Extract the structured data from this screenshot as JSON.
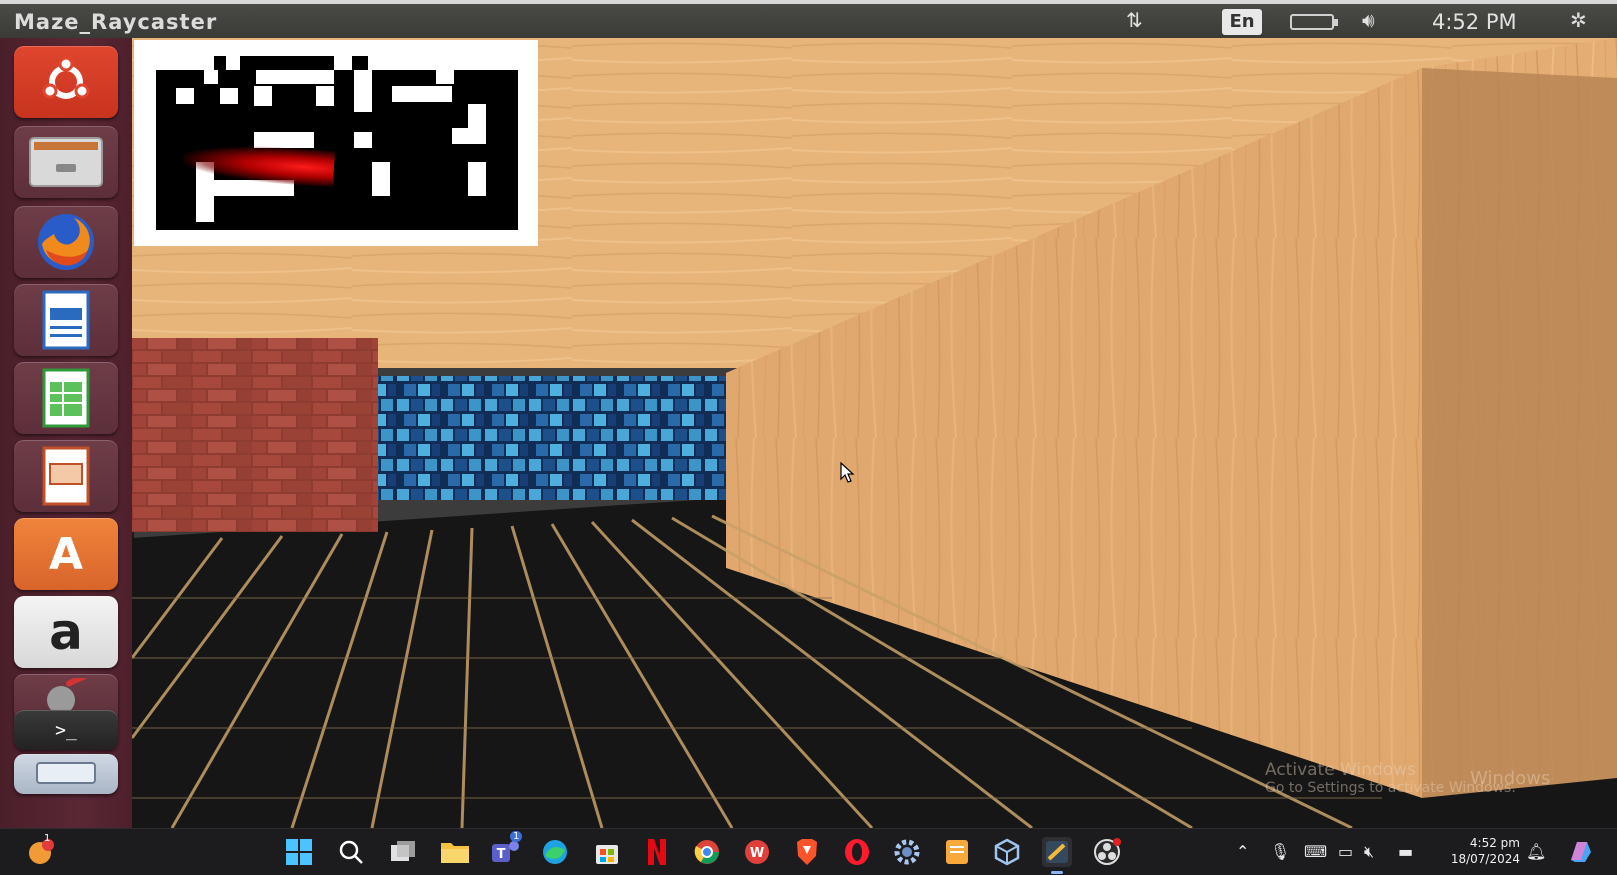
{
  "window": {
    "title": "Maze_Raycaster"
  },
  "top_panel": {
    "network_icon": "network-updown-icon",
    "language": "En",
    "battery_icon": "battery-icon",
    "volume_icon": "speaker-icon",
    "time": "4:52 PM",
    "settings_icon": "gear-power-icon"
  },
  "launcher": {
    "items": [
      {
        "name": "ubuntu-dash",
        "icon": "ubuntu-logo-icon"
      },
      {
        "name": "files",
        "icon": "file-cabinet-icon"
      },
      {
        "name": "firefox",
        "icon": "firefox-icon"
      },
      {
        "name": "writer",
        "icon": "document-icon"
      },
      {
        "name": "calc",
        "icon": "spreadsheet-icon"
      },
      {
        "name": "impress",
        "icon": "presentation-icon"
      },
      {
        "name": "software-center",
        "icon": "software-center-icon",
        "glyph": "A"
      },
      {
        "name": "amazon",
        "icon": "amazon-icon",
        "glyph": "a"
      },
      {
        "name": "system-settings",
        "icon": "settings-tools-icon"
      },
      {
        "name": "terminal",
        "icon": "terminal-icon",
        "glyph": ">_"
      },
      {
        "name": "workspace",
        "icon": "workspace-icon"
      }
    ]
  },
  "game": {
    "minimap_label": "minimap",
    "colors": {
      "ceiling_wood": "#e2ab70",
      "brick_red": "#9c4438",
      "brick_blue": "#3f8fb8",
      "floor": "#1a1a1a",
      "minimap_bg": "#000000",
      "minimap_wall": "#ffffff",
      "player_ray": "#e01010"
    }
  },
  "watermark": {
    "line1": "Activate Windows",
    "line2": "Go to Settings to activate Windows.",
    "right": "Windows"
  },
  "taskbar": {
    "notification_badge": "1",
    "teams_badge": "1",
    "items": [
      "start-icon",
      "search-icon",
      "task-view-icon",
      "file-explorer-icon",
      "teams-icon",
      "edge-icon",
      "store-icon",
      "netflix-icon",
      "chrome-icon",
      "wps-icon",
      "brave-icon",
      "opera-icon",
      "settings-icon",
      "notes-icon",
      "virtualbox-icon",
      "raycaster-icon",
      "obs-icon"
    ],
    "time": "4:52 pm",
    "date": "18/07/2024"
  }
}
